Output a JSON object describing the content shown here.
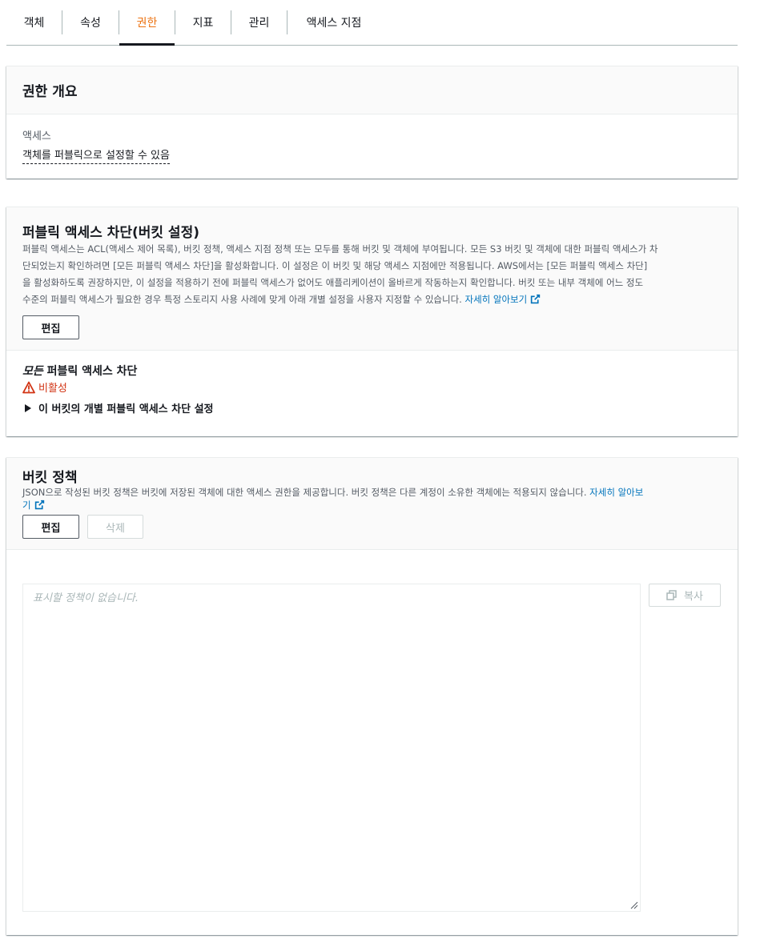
{
  "tabs": [
    {
      "label": "객체",
      "active": false
    },
    {
      "label": "속성",
      "active": false
    },
    {
      "label": "권한",
      "active": true
    },
    {
      "label": "지표",
      "active": false
    },
    {
      "label": "관리",
      "active": false
    },
    {
      "label": "액세스 지점",
      "active": false
    }
  ],
  "permissions_overview": {
    "title": "권한 개요",
    "access_label": "액세스",
    "access_value": "객체를 퍼블릭으로 설정할 수 있음"
  },
  "block_public_access": {
    "title": "퍼블릭 액세스 차단(버킷 설정)",
    "description_line1": "퍼블릭 액세스는 ACL(액세스 제어 목록), 버킷 정책, 액세스 지점 정책 또는 모두를 통해 버킷 및 객체에 부여됩니다. 모든 S3 버킷 및 객체에 대한 퍼블릭 액세스가 차",
    "description_line2": "단되었는지 확인하려면 [모든 퍼블릭 액세스 차단]을 활성화합니다. 이 설정은 이 버킷 및 해당 액세스 지점에만 적용됩니다. AWS에서는 [모든 퍼블릭 액세스 차단]",
    "description_line3": "을 활성화하도록 권장하지만, 이 설정을 적용하기 전에 퍼블릭 액세스가 없어도 애플리케이션이 올바르게 작동하는지 확인합니다. 버킷 또는 내부 객체에 어느 정도",
    "description_line4": "수준의 퍼블릭 액세스가 필요한 경우 특정 스토리지 사용 사례에 맞게 아래 개별 설정을 사용자 지정할 수 있습니다.",
    "learn_more": "자세히 알아보기",
    "edit_button": "편집",
    "block_all_label_italic": "모든",
    "block_all_label_rest": " 퍼블릭 액세스 차단",
    "status": "비활성",
    "expander_label": "이 버킷의 개별 퍼블릭 액세스 차단 설정"
  },
  "bucket_policy": {
    "title": "버킷 정책",
    "description": "JSON으로 작성된 버킷 정책은 버킷에 저장된 객체에 대한 액세스 권한을 제공합니다. 버킷 정책은 다른 계정이 소유한 객체에는 적용되지 않습니다.",
    "learn_more_part1": "자세히 알아보",
    "learn_more_part2": "기",
    "edit_button": "편집",
    "delete_button": "삭제",
    "placeholder": "표시할 정책이 없습니다.",
    "copy_button": "복사"
  },
  "colors": {
    "accent": "#ec7211",
    "link": "#0073bb",
    "warning": "#d13212"
  }
}
